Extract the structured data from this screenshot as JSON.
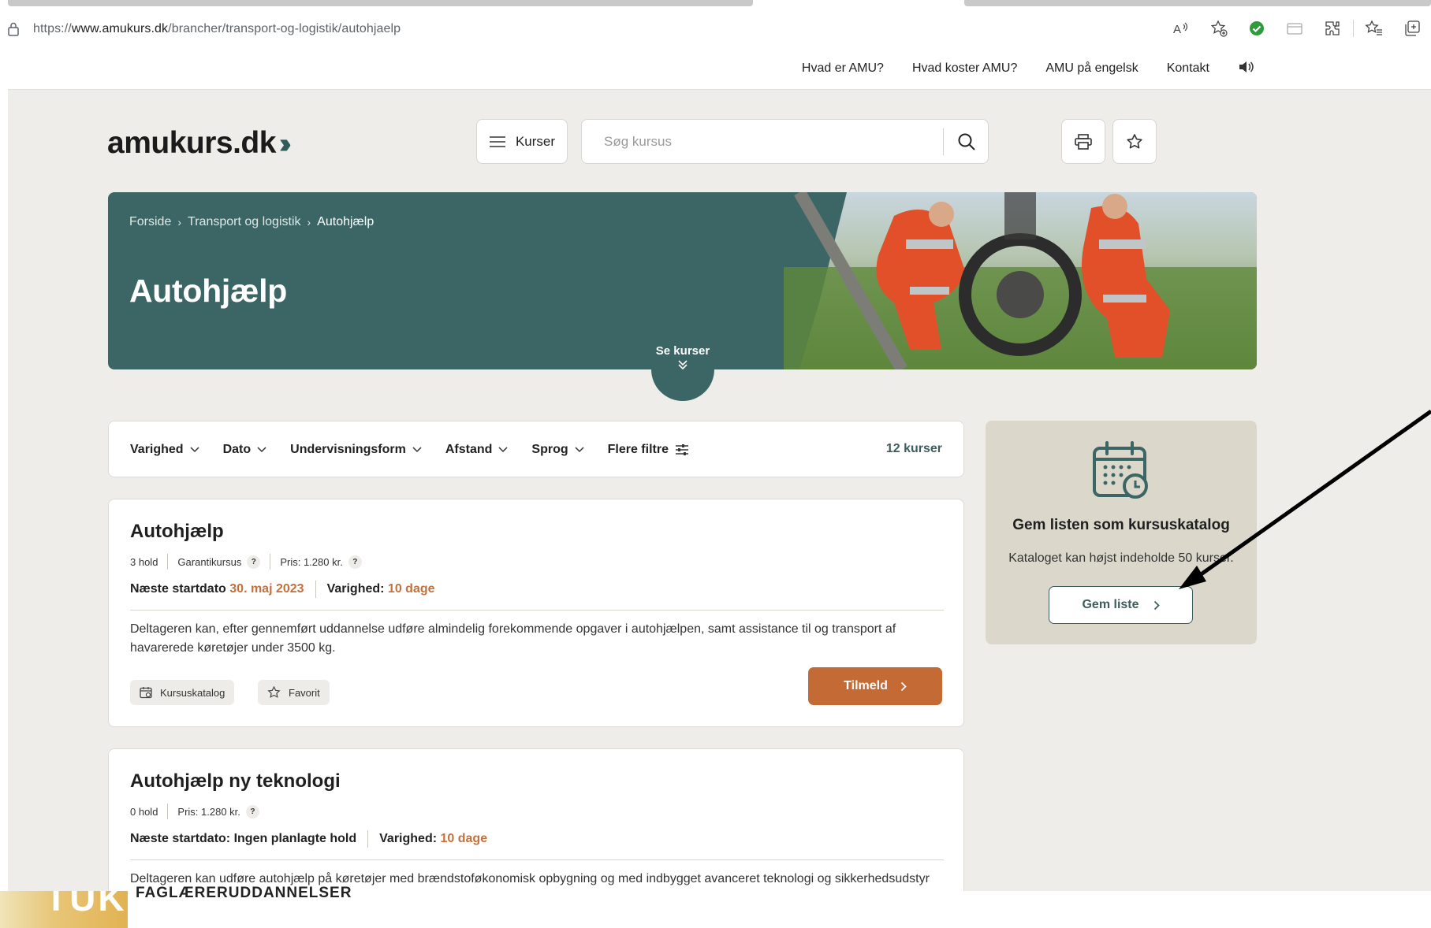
{
  "browser": {
    "url_prefix": "https://",
    "url_host": "www.amukurs.dk",
    "url_path": "/brancher/transport-og-logistik/autohjaelp",
    "icons": [
      "read-aloud-icon",
      "add-favorite-icon",
      "shield-check-icon",
      "collections-icon",
      "extensions-icon",
      "favorites-icon",
      "tabs-icon"
    ]
  },
  "topnav": {
    "links": [
      "Hvad er AMU?",
      "Hvad koster AMU?",
      "AMU på engelsk",
      "Kontakt"
    ]
  },
  "header": {
    "logo_text": "amukurs.dk",
    "logo_arrows": "»",
    "menu_label": "Kurser",
    "search_placeholder": "Søg kursus"
  },
  "hero": {
    "breadcrumb": [
      "Forside",
      "Transport og logistik",
      "Autohjælp"
    ],
    "title": "Autohjælp",
    "scroll_label": "Se kurser"
  },
  "filters": {
    "items": [
      "Varighed",
      "Dato",
      "Undervisningsform",
      "Afstand",
      "Sprog",
      "Flere filtre"
    ],
    "count": "12 kurser"
  },
  "courses": [
    {
      "title": "Autohjælp",
      "holds": "3 hold",
      "guarantee": "Garantikursus",
      "price": "Pris: 1.280 kr.",
      "start_label": "Næste startdato",
      "start_value": "30. maj 2023",
      "duration_label": "Varighed:",
      "duration_value": "10 dage",
      "description": "Deltageren kan, efter gennemført uddannelse udføre almindelig forekommende opgaver i autohjælpen, samt assistance til og transport af havarerede køretøjer under 3500 kg.",
      "catalog_label": "Kursuskatalog",
      "favorite_label": "Favorit",
      "signup_label": "Tilmeld"
    },
    {
      "title": "Autohjælp ny teknologi",
      "holds": "0 hold",
      "price": "Pris: 1.280 kr.",
      "start_label": "Næste startdato: Ingen planlagte hold",
      "duration_label": "Varighed:",
      "duration_value": "10 dage",
      "description": "Deltageren kan udføre autohjælp på køretøjer med brændstoføkonomisk opbygning og med indbygget avanceret teknologi og sikkerhedsudstyr samt på køretøjer, der fremføres med hel eller delvis el-drift."
    }
  ],
  "catalog_box": {
    "title": "Gem listen som kursuskatalog",
    "subtitle": "Kataloget kan højst indeholde 50 kurser.",
    "button": "Gem liste"
  },
  "footer": {
    "logo": "TUK",
    "text": "FAGLÆRERUDDANNELSER"
  },
  "colors": {
    "teal": "#3b6665",
    "orange": "#c46a34",
    "page_bg": "#efede9",
    "catalog_bg": "#dbd8cb"
  }
}
